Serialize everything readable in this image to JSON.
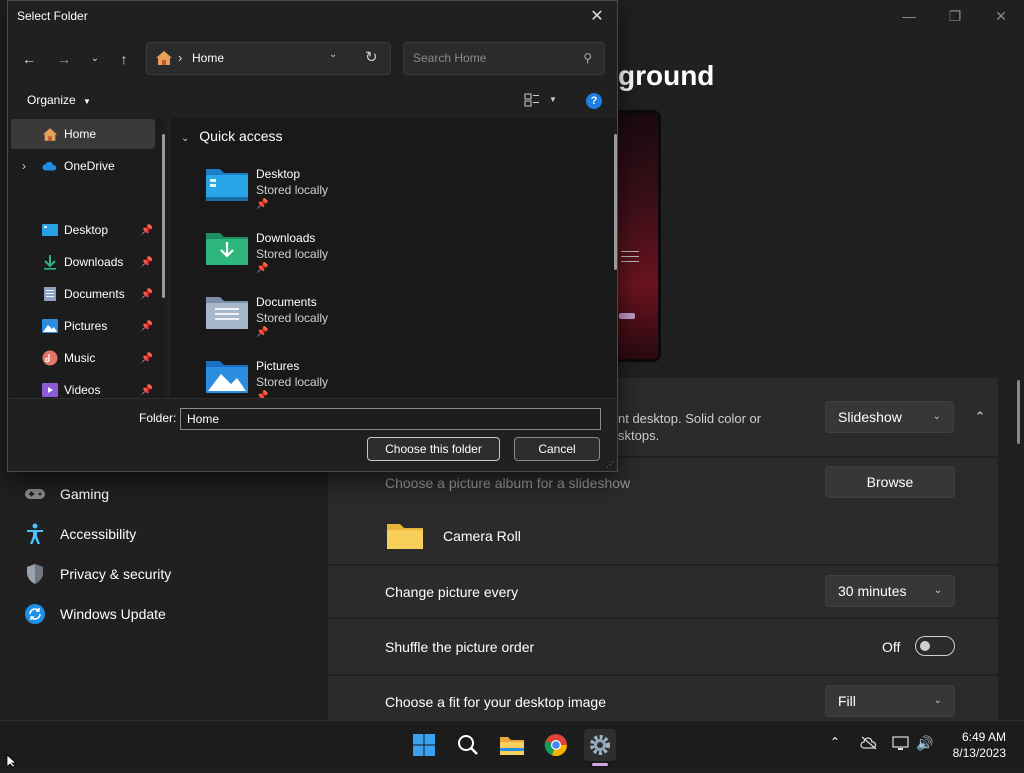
{
  "settings": {
    "page_title": "Personalize your background",
    "page_title_visible": "ground",
    "window_controls": {
      "minimize": "—",
      "maximize": "❐",
      "close": "✕"
    },
    "background_row": {
      "desc_line1": "nt desktop. Solid color or",
      "desc_line2": "sktops.",
      "dropdown": "Slideshow"
    },
    "album_row": {
      "label": "Choose a picture album for a slideshow",
      "button": "Browse"
    },
    "folder_row": {
      "label": "Camera Roll"
    },
    "interval_row": {
      "label": "Change picture every",
      "dropdown": "30 minutes"
    },
    "shuffle_row": {
      "label": "Shuffle the picture order",
      "state": "Off"
    },
    "fit_row": {
      "label": "Choose a fit for your desktop image",
      "dropdown": "Fill"
    },
    "nav": [
      {
        "label": "Gaming",
        "icon": "gaming-icon"
      },
      {
        "label": "Accessibility",
        "icon": "accessibility-icon"
      },
      {
        "label": "Privacy & security",
        "icon": "shield-icon"
      },
      {
        "label": "Windows Update",
        "icon": "windows-update-icon"
      }
    ]
  },
  "dialog": {
    "title": "Select Folder",
    "address": "Home",
    "search_placeholder": "Search Home",
    "organize": "Organize",
    "nav_pane": [
      {
        "label": "Home",
        "icon": "home-icon",
        "selected": true
      },
      {
        "label": "OneDrive",
        "icon": "onedrive-icon",
        "expandable": true
      },
      {
        "label": "Desktop",
        "icon": "desktop-folder-icon",
        "pinned": true
      },
      {
        "label": "Downloads",
        "icon": "downloads-folder-icon",
        "pinned": true
      },
      {
        "label": "Documents",
        "icon": "documents-folder-icon",
        "pinned": true
      },
      {
        "label": "Pictures",
        "icon": "pictures-folder-icon",
        "pinned": true
      },
      {
        "label": "Music",
        "icon": "music-folder-icon",
        "pinned": true
      },
      {
        "label": "Videos",
        "icon": "videos-folder-icon",
        "pinned": true
      }
    ],
    "section": "Quick access",
    "quick_access": [
      {
        "name": "Desktop",
        "sub": "Stored locally",
        "icon": "desktop-folder-icon"
      },
      {
        "name": "Downloads",
        "sub": "Stored locally",
        "icon": "downloads-folder-icon"
      },
      {
        "name": "Documents",
        "sub": "Stored locally",
        "icon": "documents-folder-icon"
      },
      {
        "name": "Pictures",
        "sub": "Stored locally",
        "icon": "pictures-folder-icon"
      }
    ],
    "folder_label": "Folder:",
    "folder_value": "Home",
    "choose_button": "Choose this folder",
    "cancel_button": "Cancel"
  },
  "taskbar": {
    "time": "6:49 AM",
    "date": "8/13/2023"
  },
  "colors": {
    "accent": "#0078d4",
    "folder_yellow": "#f5c542",
    "downloads_green": "#2fb67c",
    "desktop_blue": "#27a0e6"
  }
}
